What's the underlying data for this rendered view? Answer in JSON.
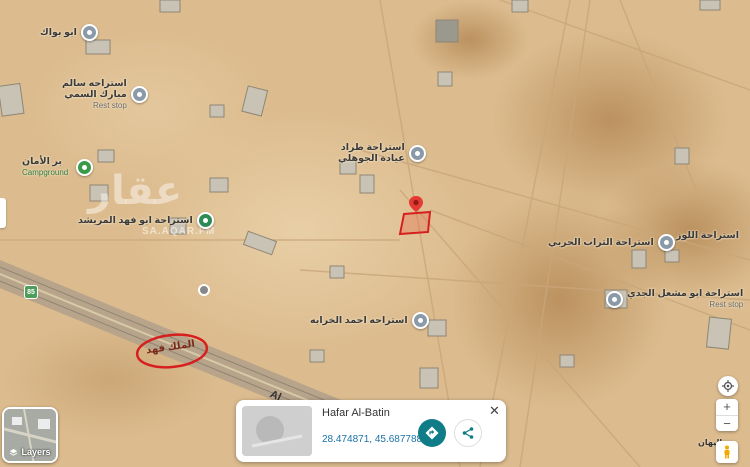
{
  "map": {
    "place_labels": [
      {
        "id": "abu-bawak",
        "lines": [
          "ابو بواك"
        ],
        "sub": ""
      },
      {
        "id": "salem",
        "lines": [
          "استراحه سالم",
          "مبارك السمي"
        ],
        "sub": "Rest stop"
      },
      {
        "id": "camp",
        "lines": [
          "بر الأمان"
        ],
        "sub": "Campground"
      },
      {
        "id": "abu-fahd",
        "lines": [
          "استراحة ابو فهد المريشد"
        ],
        "sub": ""
      },
      {
        "id": "tarad",
        "lines": [
          "استراحة طراد",
          "عيادة الجوهلي"
        ],
        "sub": ""
      },
      {
        "id": "turab",
        "lines": [
          "استراحة التراب الحربي"
        ],
        "sub": ""
      },
      {
        "id": "alloz",
        "lines": [
          "استراحة اللوز"
        ],
        "sub": ""
      },
      {
        "id": "abu-mishal",
        "lines": [
          "استراحة ابو مشعل الجدي"
        ],
        "sub": "Rest stop"
      },
      {
        "id": "ahmad",
        "lines": [
          "استراحه احمد الخرابه"
        ],
        "sub": ""
      }
    ],
    "road_label": "الملك فهد",
    "road_tag": "Al",
    "route_shield": "85",
    "watermark": "عقار",
    "watermark_sub": "SA.AQAR.FM",
    "bottom_right_label": "اليهان"
  },
  "layers_button": {
    "label": "Layers"
  },
  "place_card": {
    "title": "Hafar Al-Batin",
    "coords": "28.474871, 45.687788",
    "close_label": "✕"
  },
  "controls": {
    "zoom_in": "+",
    "zoom_out": "−"
  },
  "colors": {
    "desert": "#d9b88a",
    "pin_red": "#e53935",
    "teal": "#0f7c88",
    "annotation_red": "#d62020"
  }
}
